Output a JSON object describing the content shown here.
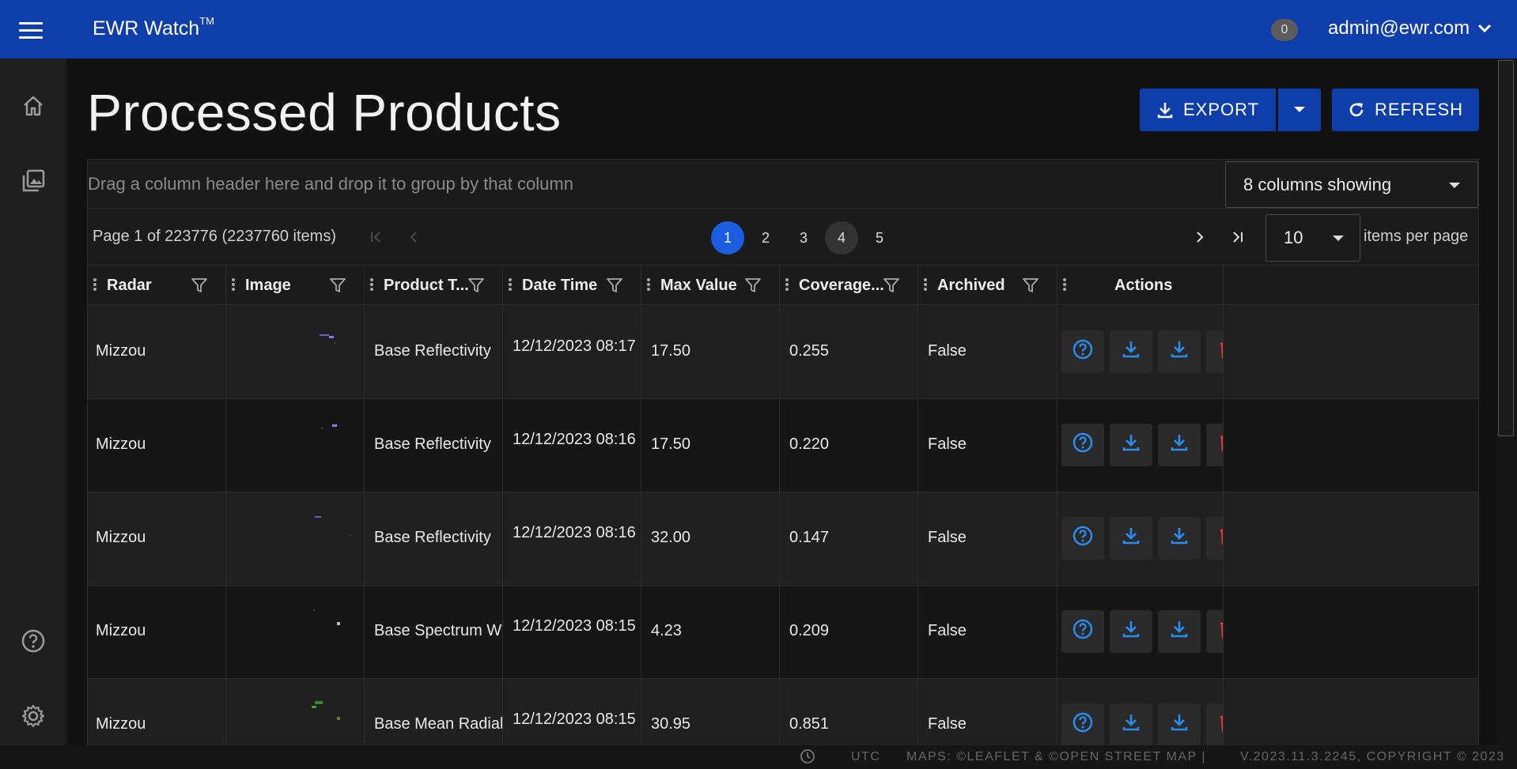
{
  "app": {
    "title": "EWR Watch",
    "trademark": "TM",
    "notification_count": "0",
    "user": "admin@ewr.com"
  },
  "sidebar": {
    "items": [
      {
        "icon": "home-icon"
      },
      {
        "icon": "gallery-icon"
      },
      {
        "icon": "help-icon"
      },
      {
        "icon": "gear-icon"
      }
    ]
  },
  "page": {
    "title": "Processed Products",
    "export_label": "EXPORT",
    "refresh_label": "REFRESH"
  },
  "grid": {
    "group_hint": "Drag a column header here and drop it to group by that column",
    "columns_showing": "8 columns showing",
    "pager": {
      "info": "Page 1 of 223776 (2237760 items)",
      "pages": [
        "1",
        "2",
        "3",
        "4",
        "5"
      ],
      "current_page": "1",
      "per_page": "10",
      "per_page_label": "items per page"
    },
    "columns": [
      "Radar",
      "Image",
      "Product T...",
      "Date Time",
      "Max Value",
      "Coverage...",
      "Archived",
      "Actions"
    ],
    "rows": [
      {
        "radar": "Mizzou",
        "product": "Base Reflectivity",
        "datetime": "12/12/2023 08:17 |",
        "max": "17.50",
        "coverage": "0.255",
        "archived": "False"
      },
      {
        "radar": "Mizzou",
        "product": "Base Reflectivity",
        "datetime": "12/12/2023 08:16 |",
        "max": "17.50",
        "coverage": "0.220",
        "archived": "False"
      },
      {
        "radar": "Mizzou",
        "product": "Base Reflectivity",
        "datetime": "12/12/2023 08:16 |",
        "max": "32.00",
        "coverage": "0.147",
        "archived": "False"
      },
      {
        "radar": "Mizzou",
        "product": "Base Spectrum Wi...",
        "datetime": "12/12/2023 08:15 |",
        "max": "4.23",
        "coverage": "0.209",
        "archived": "False"
      },
      {
        "radar": "Mizzou",
        "product": "Base Mean Radial ...",
        "datetime": "12/12/2023 08:15 |",
        "max": "30.95",
        "coverage": "0.851",
        "archived": "False"
      }
    ]
  },
  "footer": {
    "timezone": "UTC",
    "maps": "MAPS: ©LEAFLET & ©OPEN STREET MAP   |",
    "version": "V.2023.11.3.2245, COPYRIGHT © 2023"
  },
  "colors": {
    "primary": "#0d3ea9",
    "active_page": "#1a5de0",
    "action_icon": "#2a8cf0",
    "delete_icon": "#e53935"
  }
}
